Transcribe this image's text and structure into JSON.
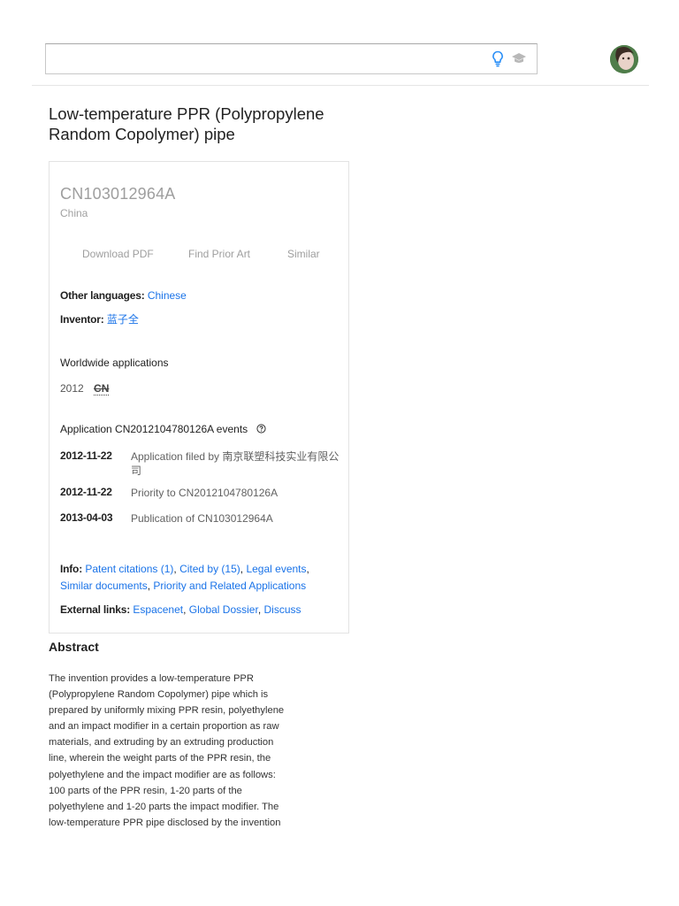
{
  "search": {
    "value": "",
    "placeholder": ""
  },
  "icons": {
    "bulb": "lightbulb-icon",
    "school": "school-icon",
    "help": "help-circle-icon"
  },
  "colors": {
    "link": "#1a73e8",
    "bulb": "#2a8ff7",
    "muted": "#9e9e9e"
  },
  "patent": {
    "title": "Low-temperature PPR (Polypropylene Random Copolymer) pipe",
    "number": "CN103012964A",
    "country": "China",
    "actions": [
      "Download PDF",
      "Find Prior Art",
      "Similar"
    ],
    "other_languages_label": "Other languages:",
    "other_languages_value": "Chinese",
    "inventor_label": "Inventor:",
    "inventor_value": "蓝子全",
    "worldwide_label": "Worldwide applications",
    "worldwide_year": "2012",
    "worldwide_country": "CN",
    "events_label": "Application CN2012104780126A events",
    "events": [
      {
        "date": "2012-11-22",
        "text": "Application filed by 南京联塑科技实业有限公司"
      },
      {
        "date": "2012-11-22",
        "text": "Priority to CN2012104780126A"
      },
      {
        "date": "2013-04-03",
        "text": "Publication of CN103012964A"
      }
    ],
    "info_label": "Info:",
    "info_links": [
      "Patent citations (1)",
      "Cited by (15)",
      "Legal events",
      "Similar documents",
      "Priority and Related Applications"
    ],
    "external_label": "External links:",
    "external_links": [
      "Espacenet",
      "Global Dossier",
      "Discuss"
    ]
  },
  "abstract": {
    "heading": "Abstract",
    "text": "The invention provides a low-temperature PPR (Polypropylene Random Copolymer) pipe which is prepared by uniformly mixing PPR resin, polyethylene and an impact modifier in a certain proportion as raw materials, and extruding by an extruding production line, wherein the weight parts of the PPR resin, the polyethylene and the impact modifier are as follows: 100 parts of the PPR resin, 1-20 parts of the polyethylene and 1-20 parts the impact modifier. The low-temperature PPR pipe disclosed by the invention"
  }
}
